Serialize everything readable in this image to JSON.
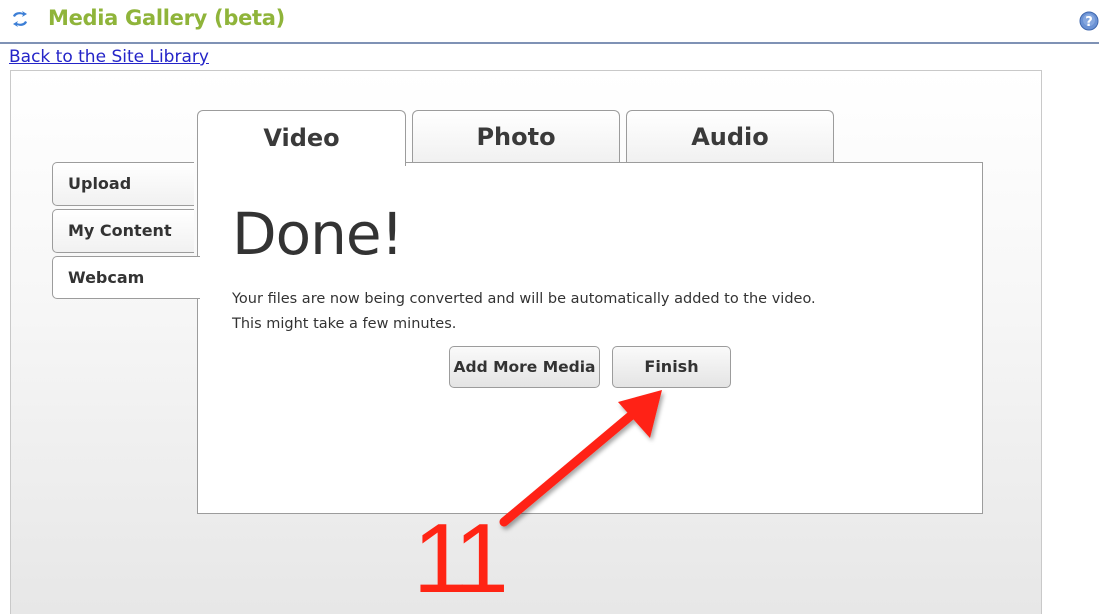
{
  "header": {
    "title": "Media Gallery (beta)",
    "sync_icon": "sync-arrows-icon",
    "help_icon": "help-question-icon"
  },
  "nav": {
    "back_link": "Back to the Site Library"
  },
  "tabs": [
    {
      "label": "Video",
      "active": true
    },
    {
      "label": "Photo",
      "active": false
    },
    {
      "label": "Audio",
      "active": false
    }
  ],
  "side_tabs": [
    {
      "label": "Upload",
      "active": false
    },
    {
      "label": "My Content",
      "active": false
    },
    {
      "label": "Webcam",
      "active": true
    }
  ],
  "content": {
    "heading": "Done!",
    "message_line1": "Your files are now being converted and will be automatically added to the video.",
    "message_line2": "This might take a few minutes.",
    "add_more_label": "Add More Media",
    "finish_label": "Finish"
  },
  "annotation": {
    "step_number": "11",
    "color": "#ff2414"
  },
  "colors": {
    "title": "#8fb43a",
    "link": "#2424c8",
    "header_rule": "#7f92b5"
  }
}
